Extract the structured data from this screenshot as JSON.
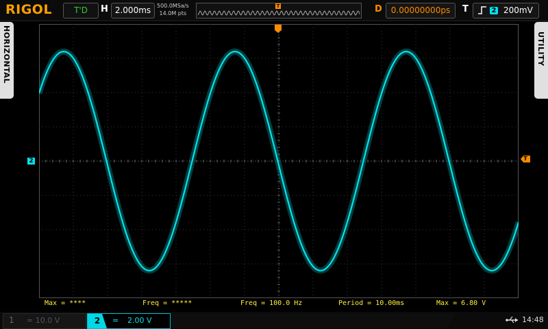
{
  "topbar": {
    "logo": "RIGOL",
    "run_status": "T'D",
    "horizontal_label": "H",
    "timebase": "2.000ms",
    "sample_rate": "500.0MSa/s",
    "memory_depth": "14.0M pts",
    "delay_label": "D",
    "delay_value": "0.00000000ps",
    "trigger_label": "T",
    "trigger_source": "2",
    "trigger_level": "200mV",
    "trigger_edge_icon": "rising-edge-icon"
  },
  "side_tabs": {
    "left": "HORIZONTAL",
    "right": "UTILITY"
  },
  "markers": {
    "channel2": "2",
    "trigger_level_marker": "T",
    "trigger_position_marker": "T"
  },
  "measurements": [
    "Max = ****",
    "Freq = *****",
    "Freq = 100.0 Hz",
    "Period = 10.00ms",
    "Max = 6.80 V"
  ],
  "bottombar": {
    "ch1_number": "1",
    "ch1_coupling": "=",
    "ch1_scale": "10.0 V",
    "ch2_number": "2",
    "ch2_coupling": "=",
    "ch2_scale": "2.00 V",
    "usb_icon": "usb-icon",
    "time": "14:48"
  },
  "colors": {
    "ch2": "#00e5ee",
    "trigger": "#ff8a00",
    "logo": "#ffa000",
    "measure": "#ffef3a",
    "status": "#2ed12e"
  },
  "chart_data": {
    "type": "line",
    "series": [
      {
        "name": "2",
        "frequency_hz": 100.0,
        "period_ms": 10.0,
        "max_v": 6.8
      }
    ],
    "x_divisions": 14,
    "y_divisions": 8,
    "time_per_div_ms": 2.0,
    "volts_per_div": 2.0,
    "grid": true
  }
}
